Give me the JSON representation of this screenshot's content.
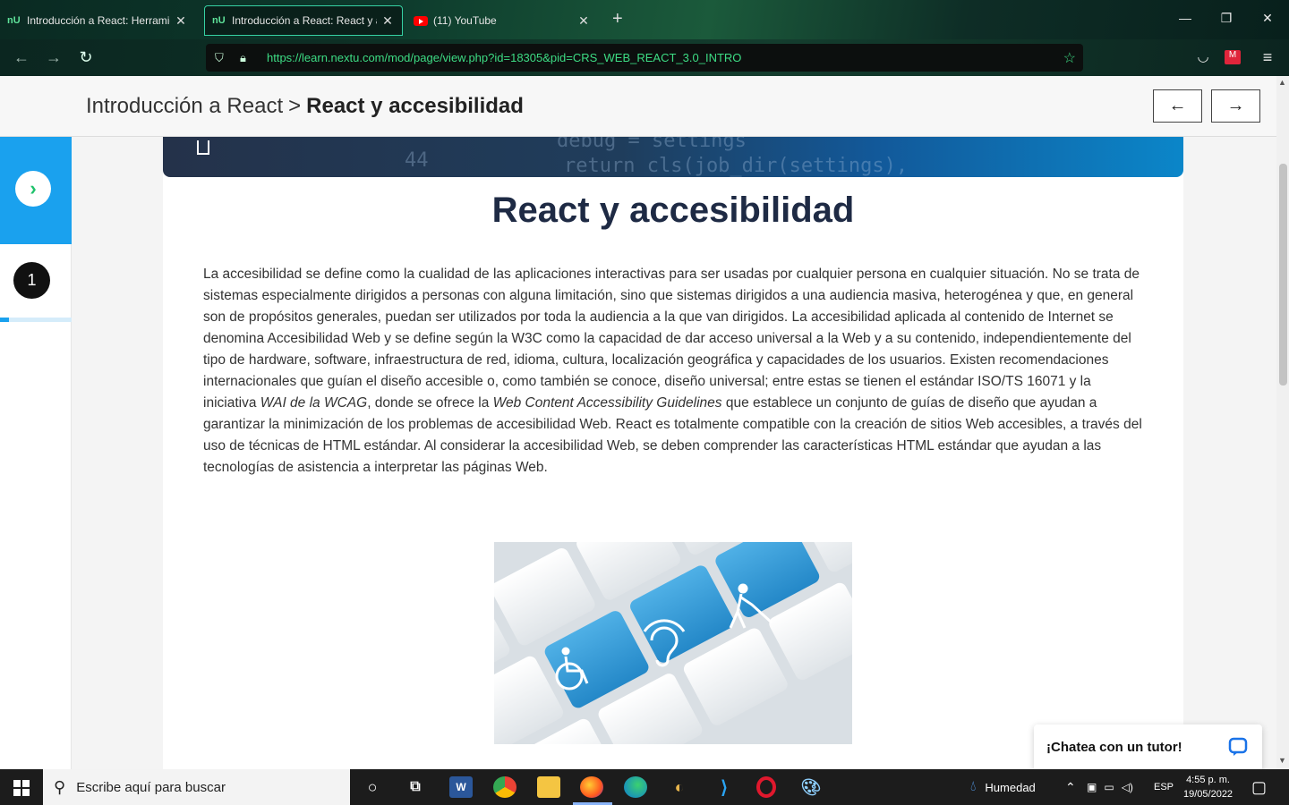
{
  "browser": {
    "tabs": [
      {
        "label": "Introducción a React: Herramie",
        "favicon": "nextu-icon",
        "active": false
      },
      {
        "label": "Introducción a React: React y ac",
        "favicon": "nextu-icon",
        "active": true
      },
      {
        "label": "(11) YouTube",
        "favicon": "youtube-icon",
        "active": false
      }
    ],
    "favicon_text": "U",
    "url": "https://learn.nextu.com/mod/page/view.php?id=18305&pid=CRS_WEB_REACT_3.0_INTRO",
    "accent": "#3ddc84"
  },
  "breadcrumb": {
    "parent": "Introducción a React",
    "separator": ">",
    "current": "React y accesibilidad"
  },
  "nav": {
    "prev": "←",
    "next": "→"
  },
  "sidebar": {
    "step": "1",
    "progress": 0.12
  },
  "banner": {
    "code_lines": [
      "debug = settings",
      "return cls(job_dir(settings),"
    ],
    "line_number": "44"
  },
  "article": {
    "title": "React y accesibilidad",
    "p1": "La accesibilidad se define como la cualidad de las aplicaciones interactivas para ser usadas por cualquier persona en cualquier situación. No se trata de sistemas especialmente dirigidos a personas con alguna limitación, sino que sistemas dirigidos a una audiencia masiva, heterogénea y que, en general son de propósitos generales, puedan ser utilizados por toda la audiencia a la que van dirigidos. La accesibilidad aplicada al contenido de Internet se denomina Accesibilidad Web y se define según la W3C como la capacidad de dar acceso universal a la Web y a su contenido, independientemente del tipo de hardware, software, infraestructura de red, idioma, cultura, localización geográfica y capacidades de los usuarios. Existen recomendaciones internacionales que guían el diseño accesible o, como también se conoce, diseño universal; entre estas se tienen el estándar ISO/TS 16071 y la iniciativa ",
    "em1": "WAI de la WCAG",
    "p2": ", donde se ofrece la ",
    "em2": "Web Content Accessibility Guidelines",
    "p3": " que establece un conjunto de guías de diseño que ayudan a garantizar la minimización de los problemas de accesibilidad Web. React es totalmente compatible con la creación de sitios Web accesibles, a través del uso de técnicas de HTML estándar. Al considerar la accesibilidad Web, se deben comprender las características HTML estándar que ayudan a las tecnologías de asistencia a interpretar las páginas Web."
  },
  "chat": {
    "label": "¡Chatea con un tutor!"
  },
  "taskbar": {
    "search_placeholder": "Escribe aquí para buscar",
    "weather": "Humedad",
    "lang": "ESP",
    "time": "4:55 p. m.",
    "date": "19/05/2022"
  }
}
